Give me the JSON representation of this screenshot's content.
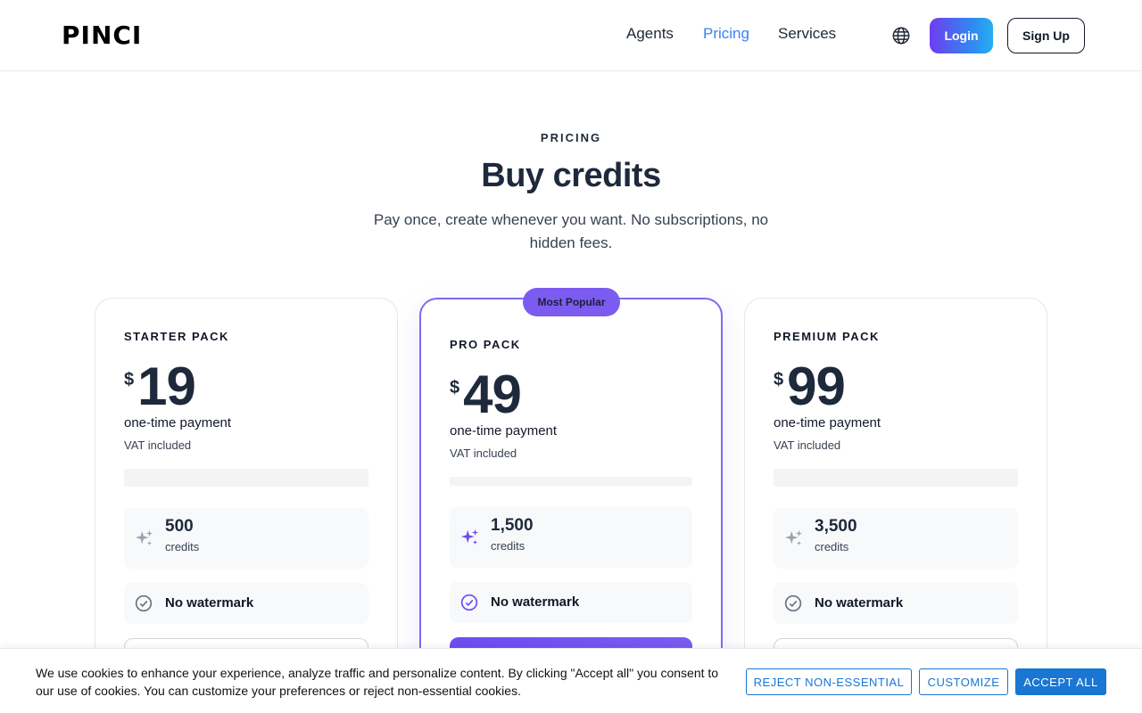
{
  "header": {
    "logo": "PINCI",
    "nav": [
      "Agents",
      "Pricing",
      "Services"
    ],
    "active_nav": "Pricing",
    "login_label": "Login",
    "signup_label": "Sign Up"
  },
  "hero": {
    "eyebrow": "PRICING",
    "title": "Buy credits",
    "subtitle": "Pay once, create whenever you want. No subscriptions, no hidden fees."
  },
  "plans": [
    {
      "name": "STARTER PACK",
      "currency": "$",
      "price": "19",
      "payment": "one-time payment",
      "vat": "VAT included",
      "credits": "500",
      "credits_label": "credits",
      "feature": "No watermark",
      "featured": false
    },
    {
      "name": "PRO PACK",
      "currency": "$",
      "price": "49",
      "payment": "one-time payment",
      "vat": "VAT included",
      "credits": "1,500",
      "credits_label": "credits",
      "feature": "No watermark",
      "featured": true,
      "badge": "Most Popular"
    },
    {
      "name": "PREMIUM PACK",
      "currency": "$",
      "price": "99",
      "payment": "one-time payment",
      "vat": "VAT included",
      "credits": "3,500",
      "credits_label": "credits",
      "feature": "No watermark",
      "featured": false
    }
  ],
  "cookie": {
    "text": "We use cookies to enhance your experience, analyze traffic and personalize content. By clicking \"Accept all\" you consent to our use of cookies. You can customize your preferences or reject non-essential cookies.",
    "reject_label": "REJECT NON-ESSENTIAL",
    "customize_label": "CUSTOMIZE",
    "accept_label": "ACCEPT ALL"
  },
  "colors": {
    "accent": "#7c5cf0",
    "link_active": "#3b82f6",
    "cookie_blue": "#1976d2"
  },
  "icons": {
    "language": "globe-icon",
    "credits": "sparkle-icon",
    "feature": "check-circle-icon"
  }
}
